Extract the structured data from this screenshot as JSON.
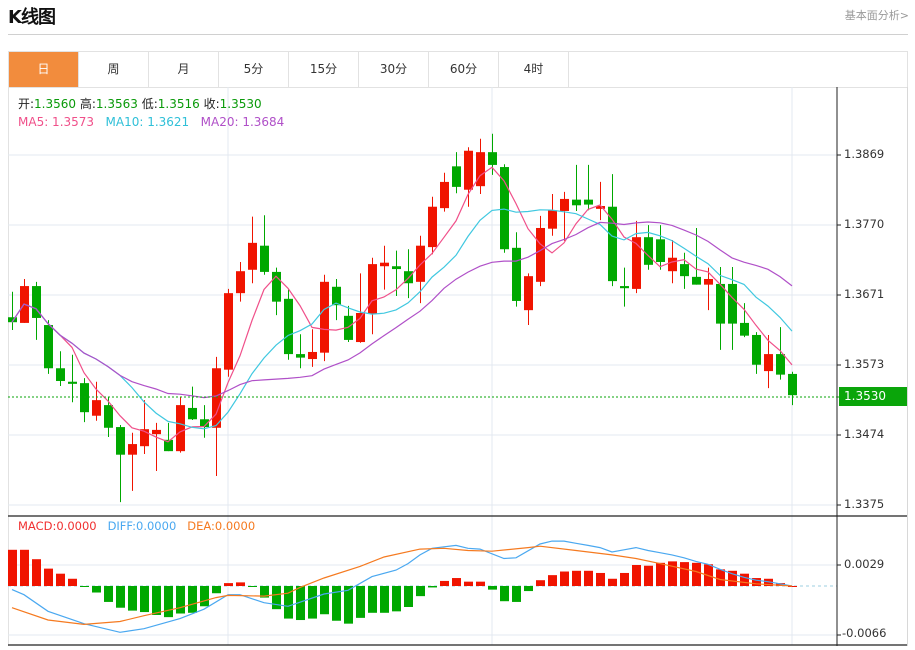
{
  "header": {
    "title": "K线图",
    "link": "基本面分析>"
  },
  "tabs": [
    {
      "label": "日",
      "active": true
    },
    {
      "label": "周"
    },
    {
      "label": "月"
    },
    {
      "label": "5分"
    },
    {
      "label": "15分"
    },
    {
      "label": "30分"
    },
    {
      "label": "60分"
    },
    {
      "label": "4时"
    }
  ],
  "legend": {
    "open_label": "开:",
    "open": "1.3560",
    "high_label": "高:",
    "high": "1.3563",
    "low_label": "低:",
    "low": "1.3516",
    "close_label": "收:",
    "close": "1.3530",
    "ma5": "MA5: 1.3573",
    "ma10": "MA10: 1.3621",
    "ma20": "MA20: 1.3684"
  },
  "macd_legend": {
    "macd": "MACD:0.0000",
    "diff": "DIFF:0.0000",
    "dea": "DEA:0.0000"
  },
  "colors": {
    "up": "#f01400",
    "down": "#00a800",
    "ma5": "#f0508a",
    "ma10": "#40c8e0",
    "ma20": "#b050c8",
    "macd": "#f03030",
    "diff": "#4aa8f0",
    "dea": "#f57a20",
    "accent": "#f28c3d"
  },
  "chart_data": {
    "type": "candlestick",
    "price_ticks": [
      "1.3869",
      "1.3770",
      "1.3671",
      "1.3573",
      "1.3474",
      "1.3375"
    ],
    "price_range": [
      1.3375,
      1.3869
    ],
    "current_price": "1.3530",
    "candles_ohlc": [
      [
        1.364,
        1.3676,
        1.3622,
        1.3633
      ],
      [
        1.3632,
        1.3694,
        1.3632,
        1.3684
      ],
      [
        1.3684,
        1.369,
        1.3608,
        1.3639
      ],
      [
        1.3629,
        1.3636,
        1.356,
        1.3568
      ],
      [
        1.3568,
        1.3592,
        1.3543,
        1.355
      ],
      [
        1.3549,
        1.3587,
        1.352,
        1.3546
      ],
      [
        1.3547,
        1.3554,
        1.3492,
        1.3506
      ],
      [
        1.3501,
        1.3549,
        1.3494,
        1.3523
      ],
      [
        1.3516,
        1.3528,
        1.3471,
        1.3484
      ],
      [
        1.3485,
        1.3488,
        1.3379,
        1.3446
      ],
      [
        1.3446,
        1.3477,
        1.3395,
        1.3461
      ],
      [
        1.3458,
        1.3523,
        1.3447,
        1.3482
      ],
      [
        1.3475,
        1.3491,
        1.3423,
        1.3481
      ],
      [
        1.3467,
        1.3491,
        1.3451,
        1.3451
      ],
      [
        1.3451,
        1.3528,
        1.3449,
        1.3516
      ],
      [
        1.3512,
        1.3542,
        1.3495,
        1.3496
      ],
      [
        1.3496,
        1.3516,
        1.347,
        1.3485
      ],
      [
        1.3484,
        1.3584,
        1.3416,
        1.3568
      ],
      [
        1.3566,
        1.368,
        1.3556,
        1.3674
      ],
      [
        1.3674,
        1.3718,
        1.3662,
        1.3705
      ],
      [
        1.3707,
        1.3782,
        1.3688,
        1.3745
      ],
      [
        1.3741,
        1.3784,
        1.37,
        1.3704
      ],
      [
        1.3704,
        1.371,
        1.3643,
        1.3662
      ],
      [
        1.3666,
        1.3679,
        1.358,
        1.3588
      ],
      [
        1.3588,
        1.3616,
        1.3568,
        1.3583
      ],
      [
        1.3581,
        1.3623,
        1.357,
        1.3591
      ],
      [
        1.359,
        1.37,
        1.3578,
        1.369
      ],
      [
        1.3683,
        1.3694,
        1.3636,
        1.3657
      ],
      [
        1.3642,
        1.3656,
        1.3605,
        1.3608
      ],
      [
        1.3605,
        1.3702,
        1.3604,
        1.3646
      ],
      [
        1.3645,
        1.3724,
        1.3616,
        1.3715
      ],
      [
        1.3712,
        1.3741,
        1.3679,
        1.3717
      ],
      [
        1.3712,
        1.3734,
        1.367,
        1.3708
      ],
      [
        1.3705,
        1.3736,
        1.3667,
        1.3688
      ],
      [
        1.369,
        1.3755,
        1.366,
        1.3741
      ],
      [
        1.3739,
        1.381,
        1.3729,
        1.3796
      ],
      [
        1.3794,
        1.3844,
        1.3789,
        1.3831
      ],
      [
        1.3853,
        1.3873,
        1.3815,
        1.3824
      ],
      [
        1.382,
        1.388,
        1.3796,
        1.3875
      ],
      [
        1.3825,
        1.3892,
        1.3814,
        1.3873
      ],
      [
        1.3873,
        1.3899,
        1.3841,
        1.3855
      ],
      [
        1.3852,
        1.3856,
        1.3731,
        1.3736
      ],
      [
        1.3738,
        1.376,
        1.3655,
        1.3663
      ],
      [
        1.365,
        1.3702,
        1.3629,
        1.3698
      ],
      [
        1.369,
        1.3783,
        1.3684,
        1.3766
      ],
      [
        1.3765,
        1.3814,
        1.3755,
        1.3791
      ],
      [
        1.379,
        1.3817,
        1.3748,
        1.3807
      ],
      [
        1.3806,
        1.3855,
        1.379,
        1.3798
      ],
      [
        1.3806,
        1.3855,
        1.3791,
        1.3799
      ],
      [
        1.3793,
        1.3831,
        1.3777,
        1.3797
      ],
      [
        1.3796,
        1.3842,
        1.3684,
        1.3691
      ],
      [
        1.3684,
        1.371,
        1.3655,
        1.3681
      ],
      [
        1.368,
        1.3776,
        1.3674,
        1.3753
      ],
      [
        1.3753,
        1.377,
        1.3707,
        1.3714
      ],
      [
        1.375,
        1.377,
        1.3707,
        1.3718
      ],
      [
        1.3705,
        1.3749,
        1.3688,
        1.3724
      ],
      [
        1.3715,
        1.3731,
        1.368,
        1.3698
      ],
      [
        1.3697,
        1.3766,
        1.3686,
        1.3686
      ],
      [
        1.3686,
        1.371,
        1.365,
        1.3694
      ],
      [
        1.3687,
        1.3711,
        1.3594,
        1.3631
      ],
      [
        1.3687,
        1.3711,
        1.3594,
        1.3631
      ],
      [
        1.3632,
        1.366,
        1.3612,
        1.3614
      ],
      [
        1.3615,
        1.3619,
        1.356,
        1.3573
      ],
      [
        1.3564,
        1.3615,
        1.354,
        1.3588
      ],
      [
        1.3588,
        1.3626,
        1.3552,
        1.3559
      ],
      [
        1.356,
        1.3563,
        1.3516,
        1.353
      ]
    ],
    "ma_periods": [
      5,
      10,
      20
    ],
    "macd": {
      "ticks": [
        "0.0029",
        "-0.0066"
      ],
      "range": [
        -0.0066,
        0.0029
      ],
      "hist": [
        0.005,
        0.005,
        0.0037,
        0.0024,
        0.0017,
        0.001,
        -0.0001,
        -0.0009,
        -0.0022,
        -0.003,
        -0.0034,
        -0.0036,
        -0.004,
        -0.0043,
        -0.0038,
        -0.0037,
        -0.0028,
        -0.001,
        0.0004,
        0.0005,
        -0.0001,
        -0.0016,
        -0.0032,
        -0.0045,
        -0.0047,
        -0.0045,
        -0.0039,
        -0.0048,
        -0.0052,
        -0.0044,
        -0.0037,
        -0.0037,
        -0.0035,
        -0.0029,
        -0.0014,
        -0.0002,
        0.0007,
        0.0011,
        0.0006,
        0.0006,
        -0.0005,
        -0.0021,
        -0.0022,
        -0.0007,
        0.0008,
        0.0015,
        0.002,
        0.0021,
        0.0021,
        0.0018,
        0.001,
        0.0018,
        0.0029,
        0.0028,
        0.0032,
        0.0034,
        0.0033,
        0.0032,
        0.003,
        0.0023,
        0.0021,
        0.0017,
        0.0011,
        0.001,
        0.0004,
        0.0
      ],
      "diff": [
        [
          1,
          -0.0005
        ],
        [
          2,
          -0.0012
        ],
        [
          4,
          -0.0035
        ],
        [
          7,
          -0.0052
        ],
        [
          10,
          -0.0064
        ],
        [
          12,
          -0.0059
        ],
        [
          15,
          -0.0045
        ],
        [
          17,
          -0.0032
        ],
        [
          19,
          -0.0012
        ],
        [
          20,
          -0.0012
        ],
        [
          22,
          -0.0023
        ],
        [
          24,
          -0.0028
        ],
        [
          27,
          -0.0011
        ],
        [
          29,
          -0.0006
        ],
        [
          31,
          0.0013
        ],
        [
          33,
          0.0022
        ],
        [
          34,
          0.0031
        ],
        [
          35,
          0.0043
        ],
        [
          36,
          0.0052
        ],
        [
          38,
          0.0056
        ],
        [
          39,
          0.0052
        ],
        [
          40,
          0.0051
        ],
        [
          42,
          0.0038
        ],
        [
          43,
          0.0039
        ],
        [
          45,
          0.0058
        ],
        [
          46,
          0.0062
        ],
        [
          47,
          0.0062
        ],
        [
          48,
          0.0059
        ],
        [
          49,
          0.0056
        ],
        [
          50,
          0.0053
        ],
        [
          51,
          0.0047
        ],
        [
          52,
          0.005
        ],
        [
          53,
          0.0053
        ],
        [
          54,
          0.0049
        ],
        [
          55,
          0.0046
        ],
        [
          56,
          0.0043
        ],
        [
          57,
          0.0039
        ],
        [
          58,
          0.0034
        ],
        [
          59,
          0.003
        ],
        [
          60,
          0.0023
        ],
        [
          61,
          0.0017
        ],
        [
          62,
          0.0012
        ],
        [
          63,
          0.0008
        ],
        [
          64,
          0.0006
        ],
        [
          65,
          0.0003
        ],
        [
          66,
          0.0
        ]
      ],
      "dea": [
        [
          1,
          -0.003
        ],
        [
          4,
          -0.0047
        ],
        [
          7,
          -0.0053
        ],
        [
          10,
          -0.0049
        ],
        [
          12,
          -0.0041
        ],
        [
          15,
          -0.003
        ],
        [
          18,
          -0.0016
        ],
        [
          19,
          -0.0013
        ],
        [
          22,
          -0.0014
        ],
        [
          24,
          -0.001
        ],
        [
          25,
          -0.0002
        ],
        [
          27,
          0.0011
        ],
        [
          30,
          0.0027
        ],
        [
          32,
          0.004
        ],
        [
          35,
          0.0051
        ],
        [
          37,
          0.0052
        ],
        [
          39,
          0.0049
        ],
        [
          41,
          0.0048
        ],
        [
          44,
          0.0053
        ],
        [
          45,
          0.0055
        ],
        [
          48,
          0.0049
        ],
        [
          51,
          0.0043
        ],
        [
          53,
          0.0038
        ],
        [
          55,
          0.0031
        ],
        [
          58,
          0.002
        ],
        [
          60,
          0.0009
        ],
        [
          63,
          0.0003
        ],
        [
          66,
          0.0
        ]
      ]
    }
  }
}
